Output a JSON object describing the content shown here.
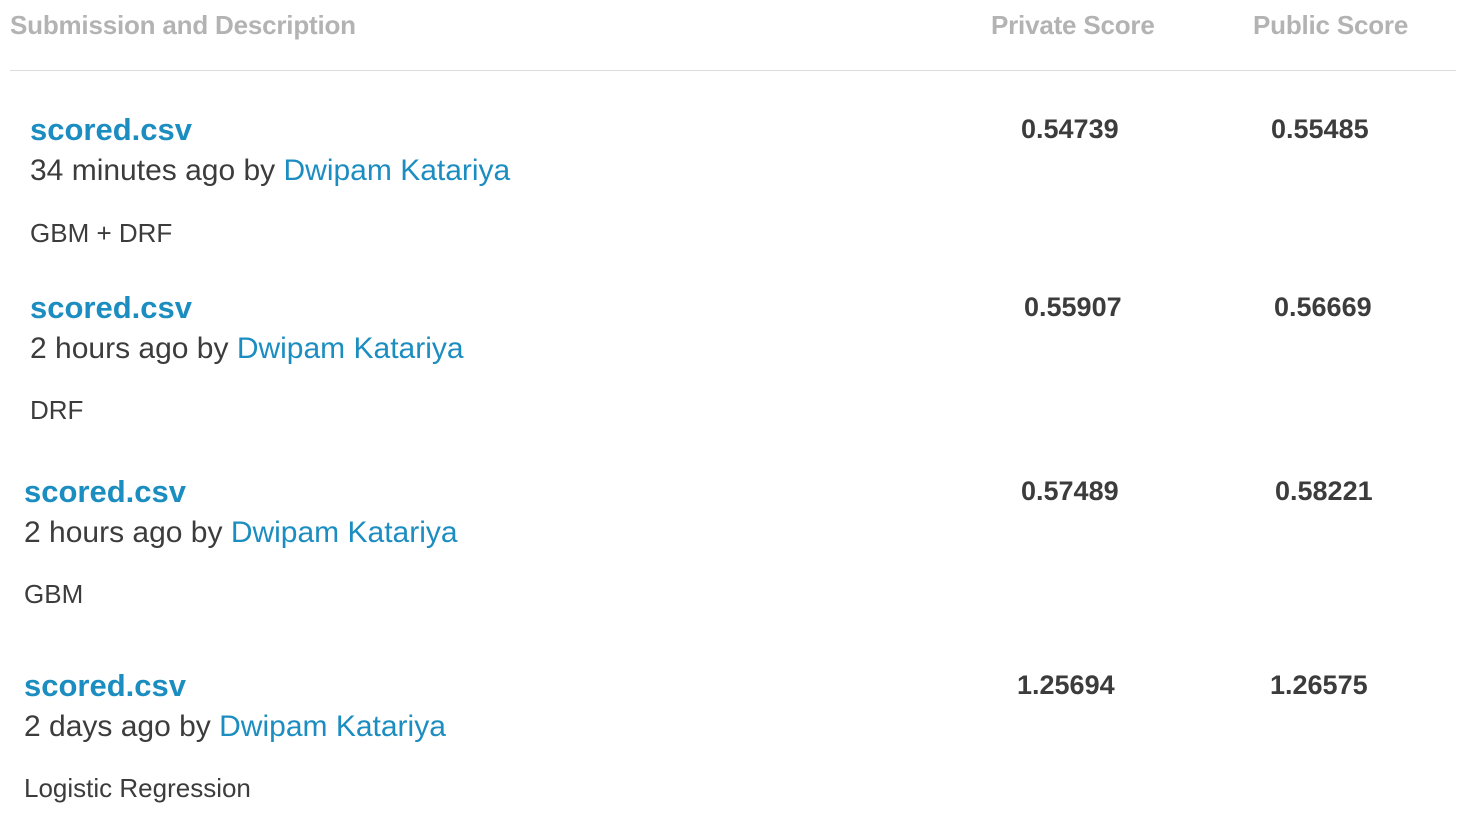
{
  "table": {
    "headers": {
      "description": "Submission and Description",
      "private_score": "Private Score",
      "public_score": "Public Score"
    },
    "rows": [
      {
        "file": "scored.csv",
        "time_prefix": "34 minutes ago by ",
        "author": "Dwipam Katariya",
        "description": "GBM + DRF",
        "private_score": "0.54739",
        "public_score": "0.55485"
      },
      {
        "file": "scored.csv",
        "time_prefix": "2 hours ago by ",
        "author": "Dwipam Katariya",
        "description": "DRF",
        "private_score": "0.55907",
        "public_score": "0.56669"
      },
      {
        "file": "scored.csv",
        "time_prefix": "2 hours ago by ",
        "author": "Dwipam Katariya",
        "description": "GBM",
        "private_score": "0.57489",
        "public_score": "0.58221"
      },
      {
        "file": "scored.csv",
        "time_prefix": "2 days ago by ",
        "author": "Dwipam Katariya",
        "description": "Logistic Regression",
        "private_score": "1.25694",
        "public_score": "1.26575"
      }
    ]
  }
}
